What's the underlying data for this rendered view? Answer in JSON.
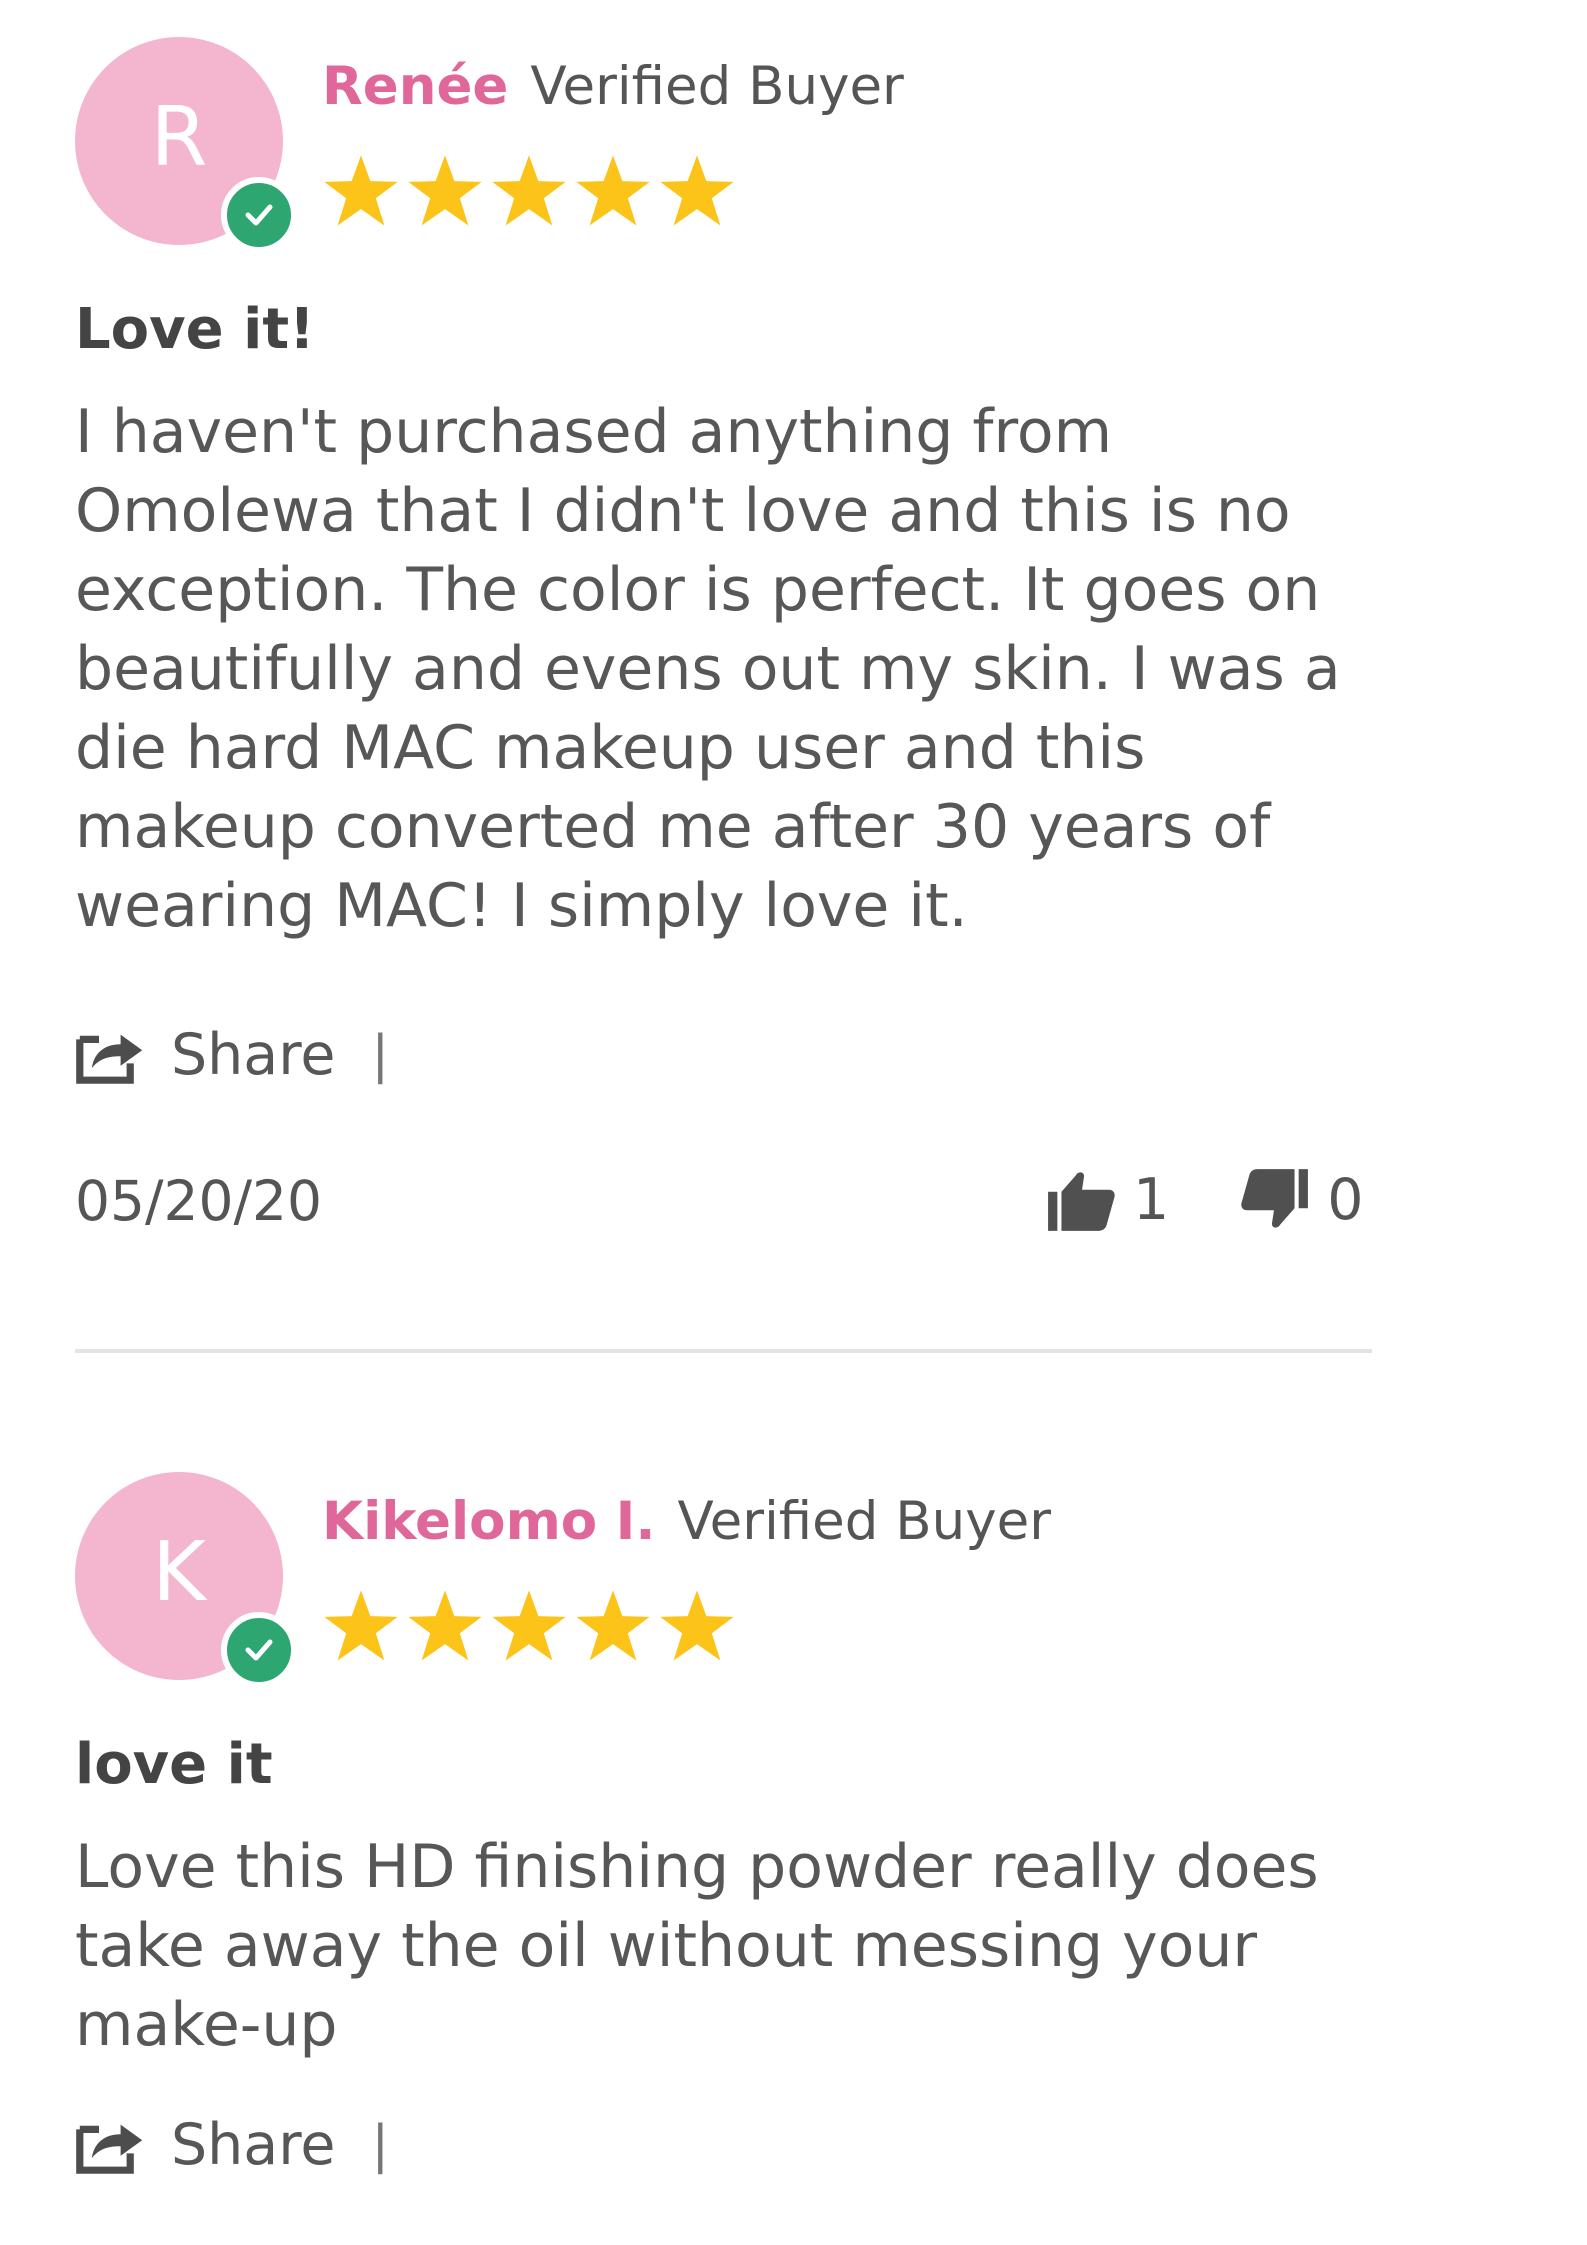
{
  "reviews": [
    {
      "avatar_letter": "R",
      "name": "Renée",
      "verified_label": "Verified Buyer",
      "rating": 5,
      "title": "Love it!",
      "body": "I haven't purchased anything from Omolewa that I didn't love and this is no exception. The color is perfect. It goes on beautifully and evens out my skin. I was a die hard MAC makeup user and this makeup converted me after 30 years of wearing MAC! I simply love it.",
      "share_label": "Share",
      "separator": "|",
      "date": "05/20/20",
      "thumbs_up_count": "1",
      "thumbs_down_count": "0"
    },
    {
      "avatar_letter": "K",
      "name": "Kikelomo I.",
      "verified_label": "Verified Buyer",
      "rating": 5,
      "title": "love it",
      "body": "Love this HD finishing powder really does take away the oil without messing your make-up",
      "share_label": "Share",
      "separator": "|"
    }
  ],
  "colors": {
    "name_accent": "#e0679a",
    "avatar_bg": "#f4b6cf",
    "verified_badge": "#2ea672",
    "star": "#fcc419",
    "text": "#555555",
    "divider": "#e4e4e4"
  },
  "icons": {
    "verified": "check-circle-icon",
    "star": "star-icon",
    "share": "share-icon",
    "thumbs_up": "thumbs-up-icon",
    "thumbs_down": "thumbs-down-icon"
  }
}
